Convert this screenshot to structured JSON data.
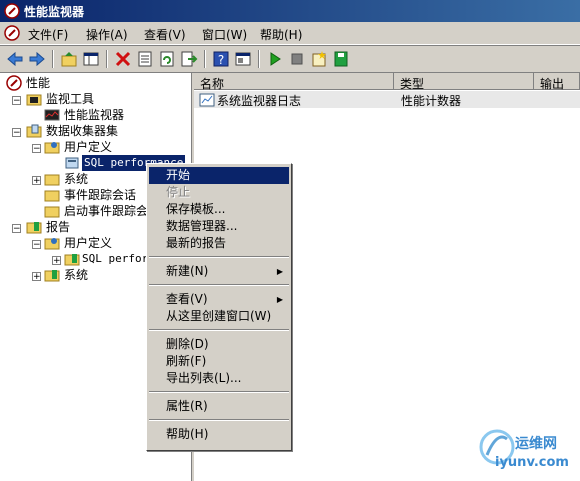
{
  "window": {
    "title": "性能监视器"
  },
  "menu": [
    "文件(F)",
    "操作(A)",
    "查看(V)",
    "窗口(W)",
    "帮助(H)"
  ],
  "toolbar": {
    "buttons": [
      "back-icon",
      "forward-icon",
      "up-folder-icon",
      "show-tree-icon",
      "delete-icon",
      "properties-icon",
      "refresh-icon",
      "export-icon",
      "help-icon",
      "console-icon",
      "start-icon",
      "stop-icon",
      "new-set-icon",
      "save-icon"
    ]
  },
  "tree": {
    "root": "性能",
    "monitor_tools": "监视工具",
    "perf_monitor": "性能监视器",
    "data_collector_sets": "数据收集器集",
    "user_defined": "用户定义",
    "sql_perf": "SQL performance",
    "system": "系统",
    "event_trace": "事件跟踪会话",
    "startup_trace": "启动事件跟踪会",
    "reports": "报告",
    "reports_user_defined": "用户定义",
    "reports_sql": "SQL perfor",
    "reports_system": "系统"
  },
  "list": {
    "columns": [
      "名称",
      "类型",
      "输出"
    ],
    "rows": [
      {
        "name": "系统监视器日志",
        "type": "性能计数器"
      }
    ]
  },
  "context_menu": {
    "start": "开始",
    "stop": "停止",
    "save_template": "保存模板...",
    "data_manager": "数据管理器...",
    "latest_report": "最新的报告",
    "new": "新建(N)",
    "view": "查看(V)",
    "new_window": "从这里创建窗口(W)",
    "delete": "删除(D)",
    "refresh": "刷新(F)",
    "export_list": "导出列表(L)...",
    "properties": "属性(R)",
    "help": "帮助(H)"
  },
  "watermark": {
    "line1": "运维网",
    "line2": "iyunv.com"
  }
}
